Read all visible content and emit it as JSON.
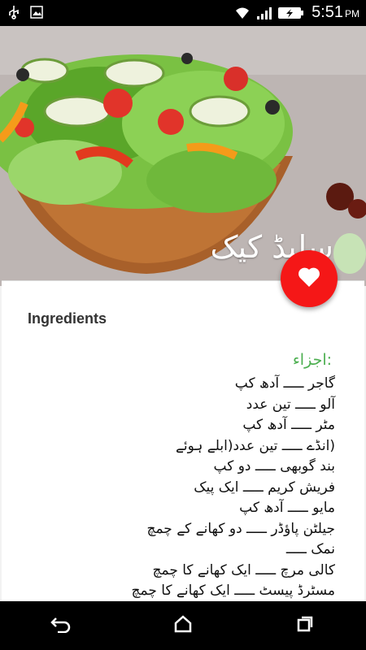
{
  "status_bar": {
    "time": "5:51",
    "ampm": "PM",
    "icons": [
      "usb-icon",
      "image-icon",
      "wifi-icon",
      "signal-icon",
      "battery-charging-icon"
    ]
  },
  "hero": {
    "title": "سلیڈ کیک",
    "image_desc": "salad-bowl-photo"
  },
  "fab": {
    "icon": "heart-icon",
    "color": "#f51717"
  },
  "card": {
    "section_title": "Ingredients",
    "heading": ":اجزاء",
    "lines": [
      "گاجر ـــــ آدھ کپ",
      "آلو ـــــ تین عدد",
      "مٹر ـــــ آدھ کپ",
      "(انڈے ـــــ تین عدد(ابلے ہوئے",
      "بند گوبھی ـــــ دو کپ",
      "فریش کریم ـــــ ایک پیک",
      "مایو ـــــ آدھ کپ",
      "جیلٹن پاؤڈر ـــــ دو کھانے کے چمچ",
      "نمک ـــــ",
      "کالی مرچ ـــــ ایک کھانے کا چمچ",
      "مسٹرڈ پیسٹ ـــــ ایک کھانے کا چمچ"
    ],
    "accent_color": "#4caf50"
  },
  "nav_bar": {
    "buttons": [
      "back-icon",
      "home-icon",
      "recents-icon"
    ]
  }
}
